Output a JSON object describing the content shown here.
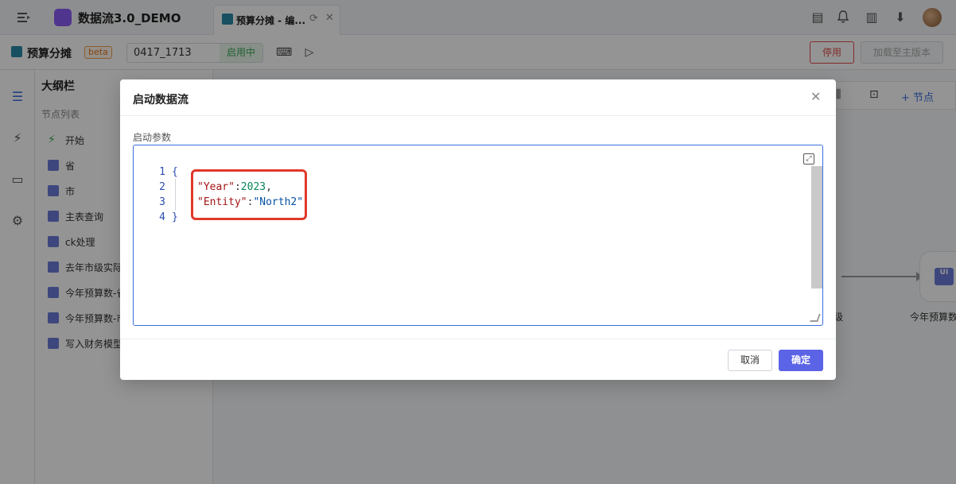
{
  "topbar": {
    "app_name": "数据流3.0_DEMO",
    "tab_label": "预算分摊 - 编...",
    "icons": [
      "menu-icon",
      "app-logo-icon",
      "refresh-icon",
      "close-icon",
      "notes-ai-icon",
      "bell-icon",
      "document-icon",
      "download-icon",
      "avatar"
    ]
  },
  "subbar": {
    "flow_title": "预算分摊",
    "beta": "beta",
    "version": "0417_1713",
    "status": "启用中",
    "stop_label": "停用",
    "load_label": "加载至主版本"
  },
  "outline": {
    "title": "大纲栏",
    "subtitle": "节点列表",
    "nodes": [
      "开始",
      "省",
      "市",
      "主表查询",
      "ck处理",
      "去年市级实际",
      "今年预算数-省",
      "今年预算数-市",
      "写入财务模型"
    ]
  },
  "canvas": {
    "add_node_label": "+ 节点",
    "node_prev_label": "级",
    "node_label": "今年预算数",
    "node_icon_text": "UI"
  },
  "modal": {
    "title": "启动数据流",
    "param_label": "启动参数",
    "line_numbers": [
      "1",
      "2",
      "3",
      "4"
    ],
    "code": {
      "open": "{",
      "year_key": "\"Year\"",
      "year_value": "2023",
      "entity_key": "\"Entity\"",
      "entity_value": "\"North2\"",
      "close": "}"
    },
    "cancel_label": "取消",
    "ok_label": "确定"
  }
}
